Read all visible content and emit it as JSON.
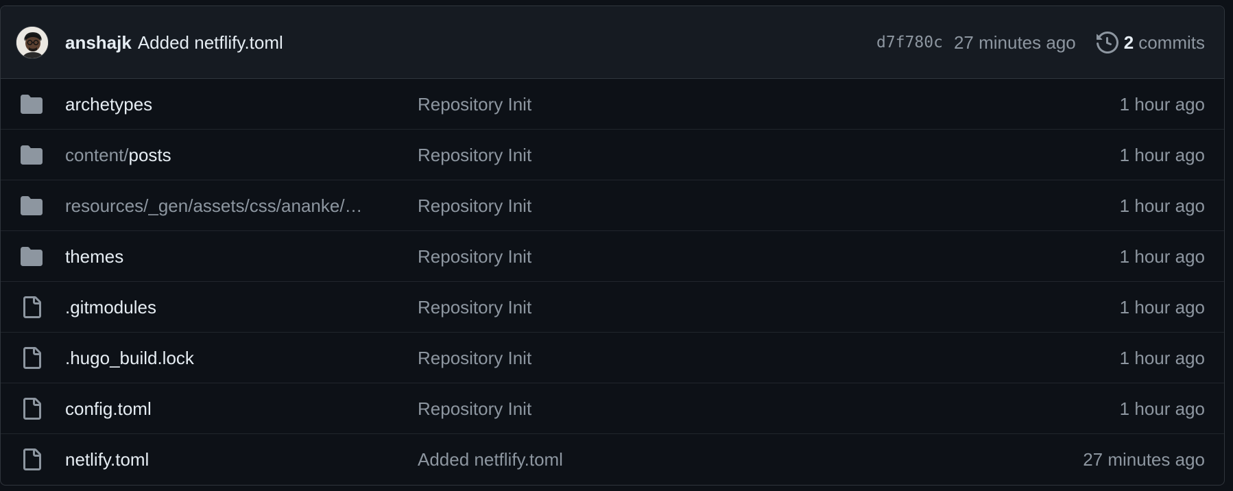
{
  "latest_commit": {
    "author": "anshajk",
    "message": "Added netflify.toml",
    "sha": "d7f780c",
    "time_ago": "27 minutes ago",
    "commit_count": "2",
    "commit_label": "commits"
  },
  "colors": {
    "background": "#0d1117",
    "header_background": "#161b22",
    "border": "#30363d",
    "text_primary": "#e6edf3",
    "text_muted": "#8d96a0",
    "folder_icon": "#8d96a0"
  },
  "files": [
    {
      "type": "folder",
      "icon": "folder-icon",
      "prefix": "",
      "name": "archetypes",
      "message": "Repository Init",
      "time": "1 hour ago"
    },
    {
      "type": "folder",
      "icon": "folder-icon",
      "prefix": "content/",
      "name": "posts",
      "message": "Repository Init",
      "time": "1 hour ago"
    },
    {
      "type": "folder",
      "icon": "folder-icon",
      "prefix": "resources/_gen/assets/css/ananke/…",
      "name": "",
      "message": "Repository Init",
      "time": "1 hour ago"
    },
    {
      "type": "folder",
      "icon": "folder-icon",
      "prefix": "",
      "name": "themes",
      "message": "Repository Init",
      "time": "1 hour ago"
    },
    {
      "type": "file",
      "icon": "file-icon",
      "prefix": "",
      "name": ".gitmodules",
      "message": "Repository Init",
      "time": "1 hour ago"
    },
    {
      "type": "file",
      "icon": "file-icon",
      "prefix": "",
      "name": ".hugo_build.lock",
      "message": "Repository Init",
      "time": "1 hour ago"
    },
    {
      "type": "file",
      "icon": "file-icon",
      "prefix": "",
      "name": "config.toml",
      "message": "Repository Init",
      "time": "1 hour ago"
    },
    {
      "type": "file",
      "icon": "file-icon",
      "prefix": "",
      "name": "netlify.toml",
      "message": "Added netflify.toml",
      "time": "27 minutes ago"
    }
  ]
}
